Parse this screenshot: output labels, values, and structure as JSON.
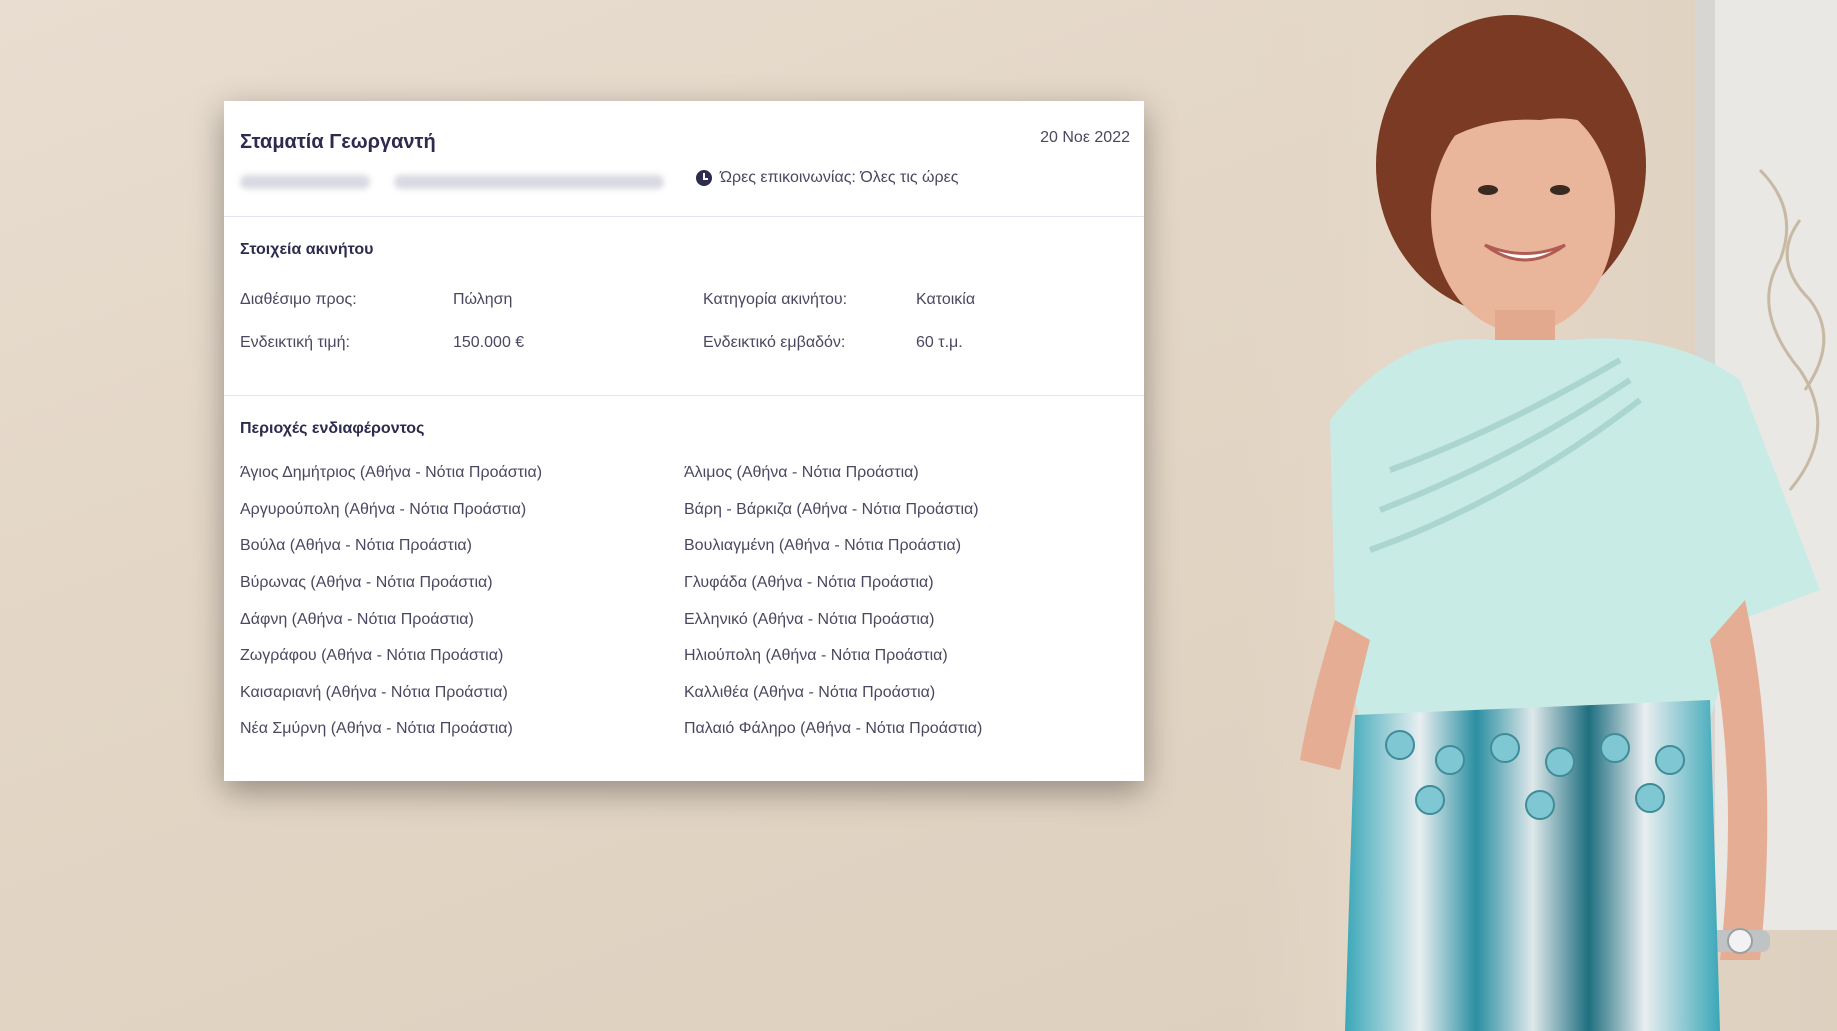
{
  "contact": {
    "name": "Σταματία Γεωργαντή",
    "date": "20 Νοε 2022",
    "hours": "Ώρες επικοινωνίας: Όλες τις ώρες"
  },
  "property": {
    "title": "Στοιχεία ακινήτου",
    "available_label": "Διαθέσιμο προς:",
    "available_value": "Πώληση",
    "category_label": "Κατηγορία ακινήτου:",
    "category_value": "Κατοικία",
    "price_label": "Ενδεικτική τιμή:",
    "price_value": "150.000 €",
    "area_label": "Ενδεικτικό εμβαδόν:",
    "area_value": "60 τ.μ."
  },
  "areas": {
    "title": "Περιοχές ενδιαφέροντος",
    "left": [
      "Άγιος Δημήτριος (Αθήνα - Νότια Προάστια)",
      "Αργυρούπολη (Αθήνα - Νότια Προάστια)",
      "Βούλα (Αθήνα - Νότια Προάστια)",
      "Βύρωνας (Αθήνα - Νότια Προάστια)",
      "Δάφνη (Αθήνα - Νότια Προάστια)",
      "Ζωγράφου (Αθήνα - Νότια Προάστια)",
      "Καισαριανή (Αθήνα - Νότια Προάστια)",
      "Νέα Σμύρνη (Αθήνα - Νότια Προάστια)"
    ],
    "right": [
      "Άλιμος (Αθήνα - Νότια Προάστια)",
      "Βάρη - Βάρκιζα (Αθήνα - Νότια Προάστια)",
      "Βουλιαγμένη (Αθήνα - Νότια Προάστια)",
      "Γλυφάδα (Αθήνα - Νότια Προάστια)",
      "Ελληνικό (Αθήνα - Νότια Προάστια)",
      "Ηλιούπολη (Αθήνα - Νότια Προάστια)",
      "Καλλιθέα (Αθήνα - Νότια Προάστια)",
      "Παλαιό Φάληρο (Αθήνα - Νότια Προάστια)"
    ]
  }
}
